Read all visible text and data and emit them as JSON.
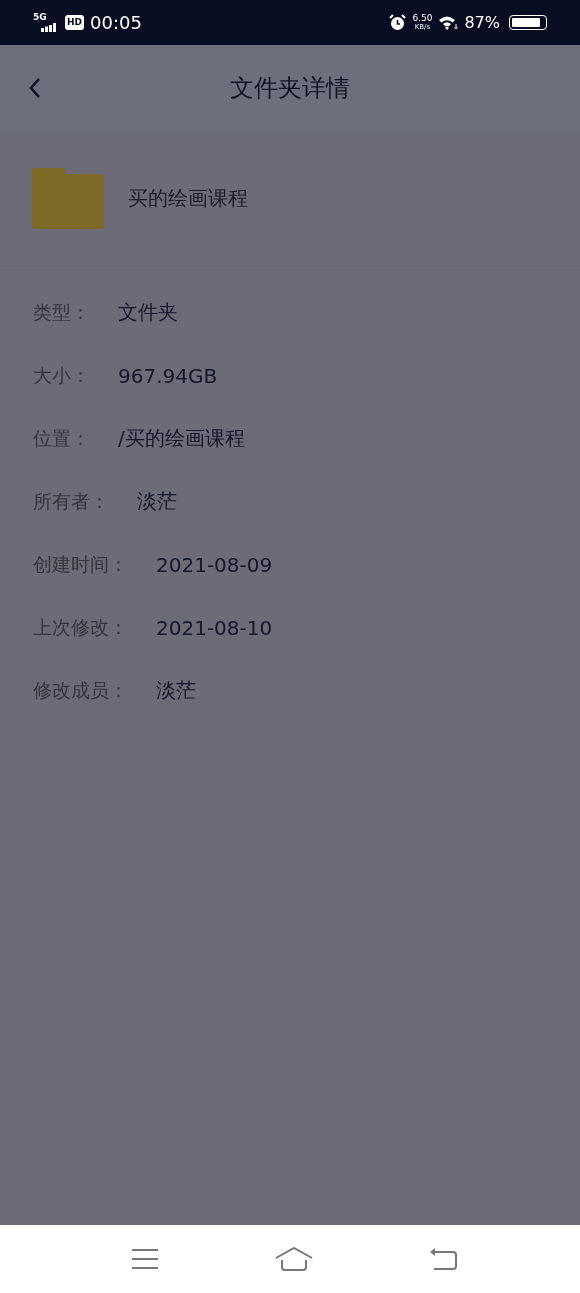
{
  "status_bar": {
    "network": "5G",
    "hd": "HD",
    "time": "00:05",
    "speed": "6.50",
    "speed_unit": "KB/s",
    "battery": "87%",
    "level": 0.87
  },
  "header": {
    "title": "文件夹详情"
  },
  "folder": {
    "name": "买的绘画课程"
  },
  "details": [
    {
      "label": "类型：",
      "value": "文件夹"
    },
    {
      "label": "大小：",
      "value": "967.94GB"
    },
    {
      "label": "位置：",
      "value": "/买的绘画课程"
    },
    {
      "label": "所有者：",
      "value": "淡茫"
    },
    {
      "label": "创建时间：",
      "value": "2021-08-09"
    },
    {
      "label": "上次修改：",
      "value": "2021-08-10"
    },
    {
      "label": "修改成员：",
      "value": "淡茫"
    }
  ]
}
